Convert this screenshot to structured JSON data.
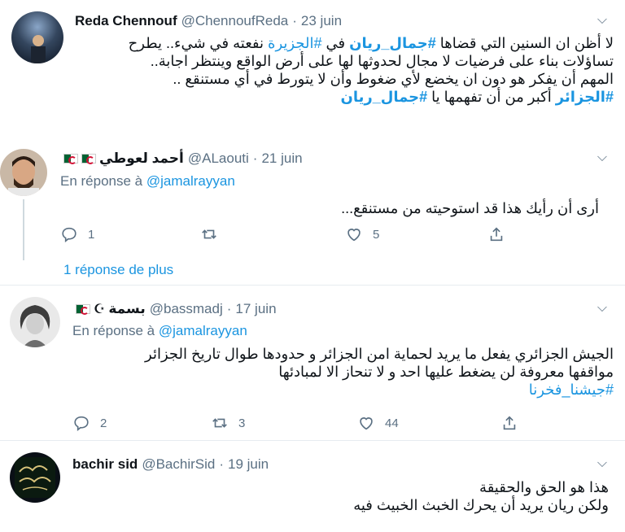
{
  "tweets": [
    {
      "name": "Reda Chennouf",
      "handle": "@ChennoufReda",
      "date": "23 juin",
      "lines": [
        [
          "لا أظن ان السنين التي قضاها ",
          "#جمال_ريان",
          " في ",
          "#الجزيرة",
          " نفعته في شيء.. يطرح"
        ],
        "تساؤلات بناء على فرضيات لا مجال لحدوثها لها على أرض الواقع وينتظر اجابة..",
        "المهم أن يفكر هو دون ان يخضع لأي ضغوط وأن لا يتورط في أي مستنقع ..",
        [
          "#الجزائر",
          " أكبر من أن تفهمها يا ",
          "#جمال_ريان"
        ]
      ]
    },
    {
      "name": "أحمد لعوطي",
      "handle": "@ALaouti",
      "date": "21 juin",
      "reply_prefix": "En réponse à",
      "reply_to": "@jamalrayyan",
      "lines": [
        "أرى أن رأيك هذا قد استوحيته من مستنقع..."
      ],
      "replies": "1",
      "likes": "5"
    },
    {
      "more_replies": "1 réponse de plus"
    },
    {
      "name": "بسمة",
      "handle": "@bassmadj",
      "date": "17 juin",
      "reply_prefix": "En réponse à",
      "reply_to": "@jamalrayyan",
      "lines": [
        "الجيش الجزائري يفعل ما يريد لحماية امن الجزائر و حدودها طوال تاريخ الجزائر",
        "مواقفها معروفة لن يضغط عليها احد و لا تنحاز الا لمبادئها",
        "#جيشنا_فخرنا"
      ],
      "replies": "2",
      "retweets": "3",
      "likes": "44"
    },
    {
      "name": "bachir sid",
      "handle": "@BachirSid",
      "date": "19 juin",
      "lines": [
        "هذا هو الحق والحقيقة",
        "ولكن ريان يريد أن يحرك الخبث الخبيث فيه"
      ]
    }
  ],
  "icons": {
    "reply": "reply-icon",
    "retweet": "retweet-icon",
    "like": "heart-icon",
    "share": "share-icon",
    "caret": "chevron-down-icon"
  },
  "colors": {
    "link": "#1b95e0",
    "muted": "#5b7083",
    "divider": "#e6ecf0"
  }
}
